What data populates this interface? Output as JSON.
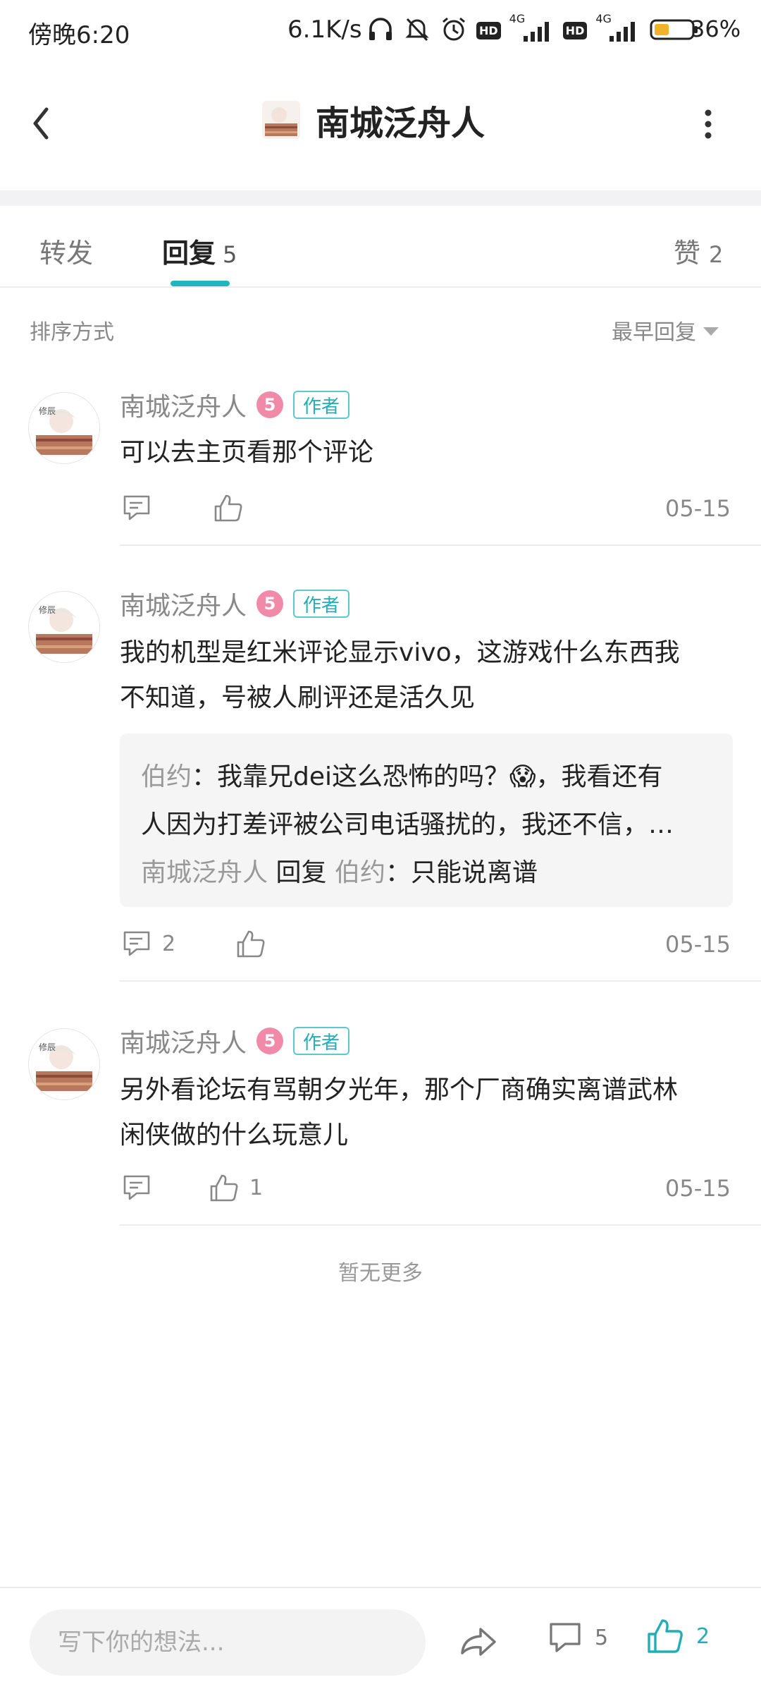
{
  "status_bar": {
    "time": "傍晚6:20",
    "net_speed": "6.1K/s",
    "battery": "36%",
    "icons": [
      "headphones-icon",
      "bell-off-icon",
      "alarm-icon",
      "hd-icon",
      "signal-4g-icon",
      "hd-icon",
      "signal-4g-icon",
      "battery-icon"
    ],
    "hd": "HD",
    "net_type": "4G"
  },
  "header": {
    "title": "南城泛舟人"
  },
  "tabs": {
    "forward": "转发",
    "reply": "回复",
    "reply_count": "5",
    "like": "赞",
    "like_count": "2"
  },
  "sort": {
    "label": "排序方式",
    "value": "最早回复"
  },
  "comments": [
    {
      "name": "南城泛舟人",
      "level": "5",
      "tag": "作者",
      "text_lines": [
        "可以去主页看那个评论"
      ],
      "comment_count": "",
      "like_count": "",
      "date": "05-15"
    },
    {
      "name": "南城泛舟人",
      "level": "5",
      "tag": "作者",
      "text_lines": [
        "我的机型是红米评论显示vivo，这游戏什么东西我",
        "不知道，号被人刷评还是活久见"
      ],
      "replies": {
        "line1_name": "伯约",
        "line1_text": "：我靠兄dei这么恐怖的吗？😱，我看还有",
        "line2_text": "人因为打差评被公司电话骚扰的，我还不信，…",
        "line3_name": "南城泛舟人",
        "line3_verb": "回复",
        "line3_target": "伯约",
        "line3_text": "：只能说离谱"
      },
      "comment_count": "2",
      "like_count": "",
      "date": "05-15"
    },
    {
      "name": "南城泛舟人",
      "level": "5",
      "tag": "作者",
      "text_lines": [
        "另外看论坛有骂朝夕光年，那个厂商确实离谱武林",
        "闲侠做的什么玩意儿"
      ],
      "comment_count": "",
      "like_count": "1",
      "date": "05-15"
    }
  ],
  "footer_text": "暂无更多",
  "bottom_bar": {
    "placeholder": "写下你的想法...",
    "comment_count": "5",
    "like_count": "2"
  },
  "colors": {
    "accent": "#22b5bd",
    "badge_pink": "#f08aa8",
    "text_muted": "#888888"
  }
}
